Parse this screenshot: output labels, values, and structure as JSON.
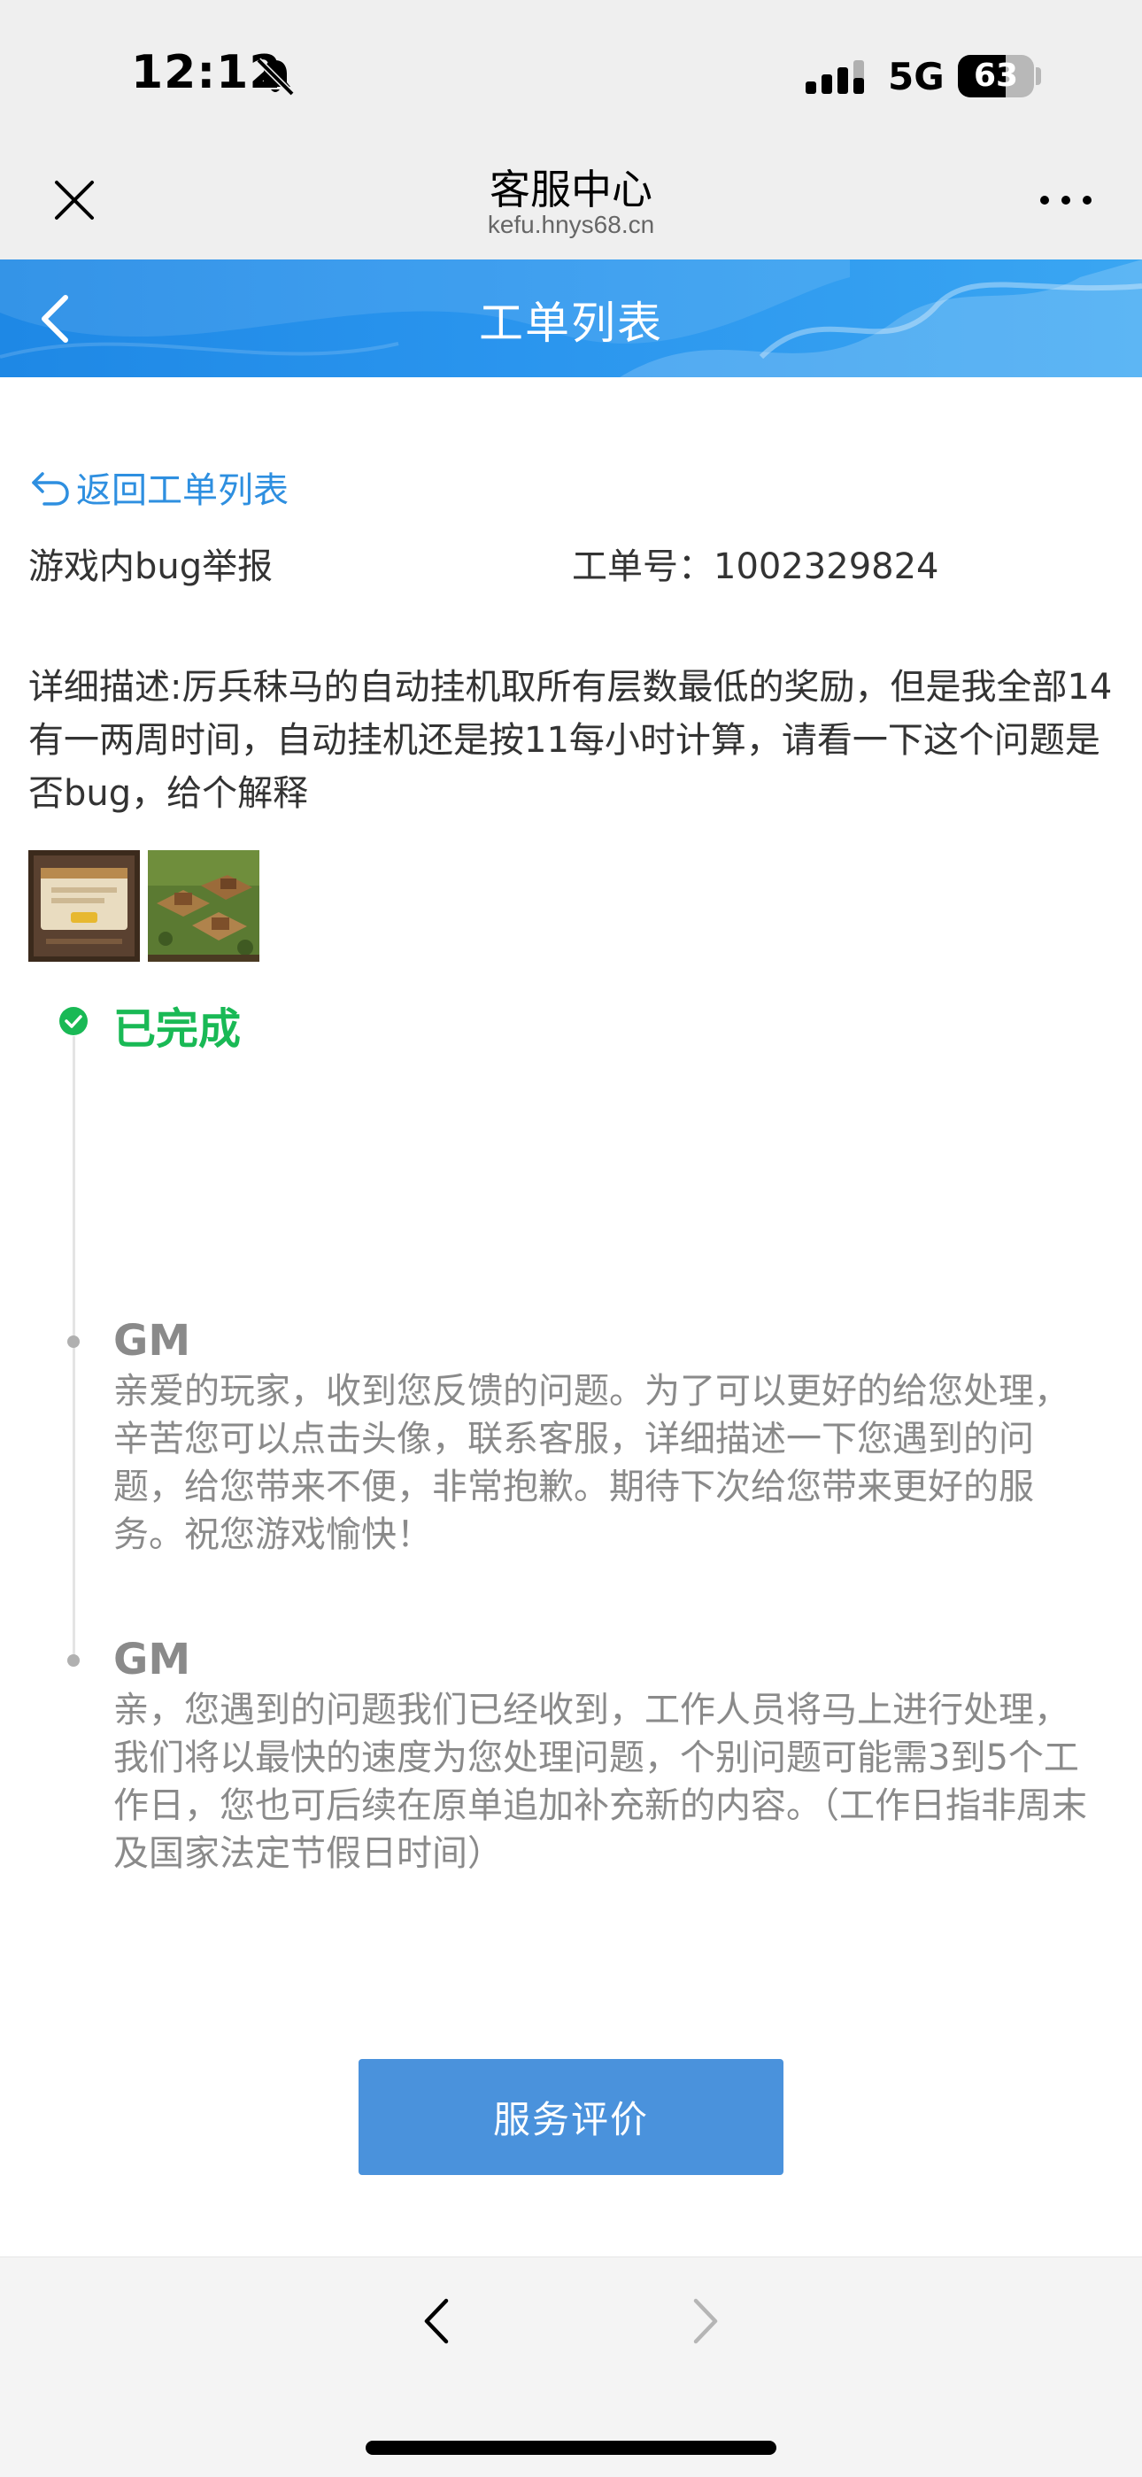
{
  "status_bar": {
    "time": "12:12",
    "network": "5G",
    "battery_level": "63"
  },
  "browser": {
    "title": "客服中心",
    "url": "kefu.hnys68.cn"
  },
  "page": {
    "header_title": "工单列表",
    "return_link_label": "返回工单列表",
    "ticket_type": "游戏内bug举报",
    "ticket_number": "工单号：1002329824",
    "description": "详细描述:厉兵秣马的自动挂机取所有层数最低的奖励，但是我全部14有一两周时间，自动挂机还是按11每小时计算，请看一下这个问题是否bug，给个解释",
    "status_label": "已完成",
    "status_color": "#19b955",
    "replies": [
      {
        "author": "GM",
        "text": "亲爱的玩家，收到您反馈的问题。为了可以更好的给您处理，辛苦您可以点击头像，联系客服，详细描述一下您遇到的问题，给您带来不便，非常抱歉。期待下次给您带来更好的服务。祝您游戏愉快！"
      },
      {
        "author": "GM",
        "text": "亲，您遇到的问题我们已经收到，工作人员将马上进行处理，我们将以最快的速度为您处理问题，个别问题可能需3到5个工作日，您也可后续在原单追加补充新的内容。（工作日指非周末及国家法定节假日时间）"
      }
    ],
    "rate_button_label": "服务评价"
  },
  "colors": {
    "banner": "#1e88e5",
    "link": "#2e8fe0",
    "button": "#4a92dc"
  },
  "icons": {
    "close": "close-icon",
    "more": "more-icon",
    "back": "chevron-left-icon",
    "return": "return-arrow-icon",
    "status": "check-circle-icon",
    "nav_back": "chevron-left-icon",
    "nav_forward": "chevron-right-icon"
  }
}
